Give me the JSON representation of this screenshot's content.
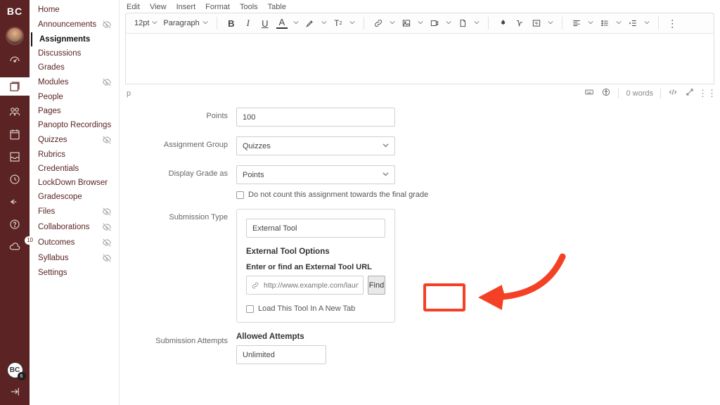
{
  "rail": {
    "logo_text": "BC",
    "badge_count": "10",
    "avatar_mini_text": "BC",
    "avatar_mini_count": "6"
  },
  "course_nav": [
    {
      "label": "Home",
      "hidden": false,
      "active": false
    },
    {
      "label": "Announcements",
      "hidden": true,
      "active": false
    },
    {
      "label": "Assignments",
      "hidden": false,
      "active": true
    },
    {
      "label": "Discussions",
      "hidden": false,
      "active": false
    },
    {
      "label": "Grades",
      "hidden": false,
      "active": false
    },
    {
      "label": "Modules",
      "hidden": true,
      "active": false
    },
    {
      "label": "People",
      "hidden": false,
      "active": false
    },
    {
      "label": "Pages",
      "hidden": false,
      "active": false
    },
    {
      "label": "Panopto Recordings",
      "hidden": false,
      "active": false
    },
    {
      "label": "Quizzes",
      "hidden": true,
      "active": false
    },
    {
      "label": "Rubrics",
      "hidden": false,
      "active": false
    },
    {
      "label": "Credentials",
      "hidden": false,
      "active": false
    },
    {
      "label": "LockDown Browser",
      "hidden": false,
      "active": false
    },
    {
      "label": "Gradescope",
      "hidden": false,
      "active": false
    },
    {
      "label": "Files",
      "hidden": true,
      "active": false
    },
    {
      "label": "Collaborations",
      "hidden": true,
      "active": false
    },
    {
      "label": "Outcomes",
      "hidden": true,
      "active": false
    },
    {
      "label": "Syllabus",
      "hidden": true,
      "active": false
    },
    {
      "label": "Settings",
      "hidden": false,
      "active": false
    }
  ],
  "editor": {
    "menu": [
      "Edit",
      "View",
      "Insert",
      "Format",
      "Tools",
      "Table"
    ],
    "font_size": "12pt",
    "block_format": "Paragraph",
    "status_tag": "p",
    "word_count": "0 words"
  },
  "form": {
    "points": {
      "label": "Points",
      "value": "100"
    },
    "assignment_group": {
      "label": "Assignment Group",
      "value": "Quizzes"
    },
    "display_grade_as": {
      "label": "Display Grade as",
      "value": "Points"
    },
    "omit_final": {
      "label": "Do not count this assignment towards the final grade"
    },
    "submission_type": {
      "label": "Submission Type",
      "value": "External Tool"
    },
    "ext_options_header": "External Tool Options",
    "ext_tool_label": "Enter or find an External Tool URL",
    "url_placeholder": "http://www.example.com/launch",
    "find_button": "Find",
    "new_tab": "Load This Tool In A New Tab",
    "submission_attempts": {
      "label": "Submission Attempts"
    },
    "allowed_attempts": {
      "label": "Allowed Attempts",
      "value": "Unlimited"
    }
  }
}
